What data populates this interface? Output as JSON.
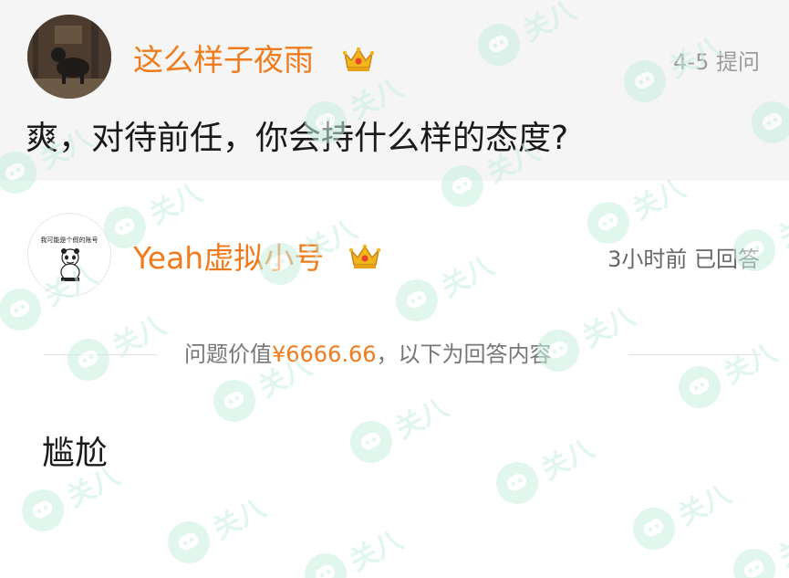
{
  "question": {
    "asker_name": "这么样子夜雨",
    "badge_icon": "crown-icon",
    "date": "4-5",
    "action": "提问",
    "text": "爽，对待前任，你会持什么样的态度?"
  },
  "answer": {
    "answerer_name": "Yeah虚拟小号",
    "badge_icon": "crown-icon",
    "avatar_caption": "我可能是个假的账号",
    "time": "3小时前",
    "status": "已回答",
    "value_prefix": "问题价值",
    "value_amount": "¥6666.66",
    "value_suffix": "，以下为回答内容",
    "text": "尴尬"
  },
  "watermark": {
    "text": "关八",
    "icon": "chat-bubble-icon"
  },
  "colors": {
    "accent_orange": "#ef7b1c",
    "question_bg": "#f5f5f5",
    "watermark_green": "#c9efe0",
    "meta_gray": "#9b9b9b"
  }
}
